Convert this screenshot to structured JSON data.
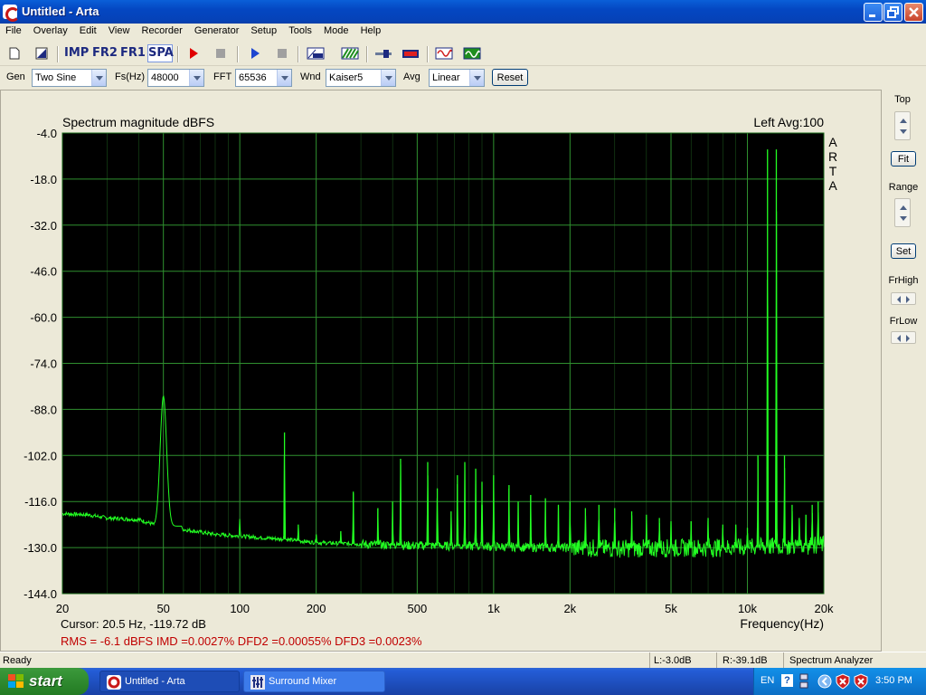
{
  "window": {
    "title": "Untitled - Arta"
  },
  "menu": [
    "File",
    "Overlay",
    "Edit",
    "View",
    "Recorder",
    "Generator",
    "Setup",
    "Tools",
    "Mode",
    "Help"
  ],
  "toolbar": {
    "imp": "IMP",
    "fr2": "FR2",
    "fr1": "FR1",
    "spa": "SPA"
  },
  "options": {
    "gen_label": "Gen",
    "gen_value": "Two Sine",
    "fs_label": "Fs(Hz)",
    "fs_value": "48000",
    "fft_label": "FFT",
    "fft_value": "65536",
    "wnd_label": "Wnd",
    "wnd_value": "Kaiser5",
    "avg_label": "Avg",
    "avg_value": "Linear",
    "reset_label": "Reset"
  },
  "side": {
    "top_label": "Top",
    "fit_label": "Fit",
    "range_label": "Range",
    "set_label": "Set",
    "frhigh_label": "FrHigh",
    "frlow_label": "FrLow"
  },
  "status": {
    "ready": "Ready",
    "left_level": "L:-3.0dB",
    "right_level": "R:-39.1dB",
    "mode": "Spectrum Analyzer"
  },
  "taskbar": {
    "start": "start",
    "tasks": [
      "Untitled - Arta",
      "Surround Mixer"
    ],
    "lang": "EN",
    "help": "?",
    "time": "3:50 PM"
  },
  "colors": {
    "plot_bg": "#000000",
    "grid": "#2F8F2F",
    "trace": "#22FF22",
    "readout_red": "#C00000"
  },
  "chart_data": {
    "type": "line",
    "title": "Spectrum magnitude dBFS",
    "channel_info": "Left  Avg:100",
    "side_label": "ARTA",
    "xlabel": "Frequency(Hz)",
    "x_scale": "log",
    "xlim": [
      20,
      20000
    ],
    "ylim": [
      -144,
      -4
    ],
    "x_tick_labels": [
      "20",
      "50",
      "100",
      "200",
      "500",
      "1k",
      "2k",
      "5k",
      "10k",
      "20k"
    ],
    "x_tick_values": [
      20,
      50,
      100,
      200,
      500,
      1000,
      2000,
      5000,
      10000,
      20000
    ],
    "y_ticks": [
      -4.0,
      -18.0,
      -32.0,
      -46.0,
      -60.0,
      -74.0,
      -88.0,
      -102.0,
      -116.0,
      -130.0,
      -144.0
    ],
    "grid": true,
    "cursor_text": "Cursor:    20.5 Hz, -119.72 dB",
    "readout_text": "RMS =    -6.1 dBFS   IMD =0.0027%   DFD2 =0.00055%   DFD3 =0.0023%",
    "noise_floor": [
      [
        20,
        -119.7
      ],
      [
        25,
        -120
      ],
      [
        30,
        -121
      ],
      [
        40,
        -121.5
      ],
      [
        46,
        -123
      ],
      [
        60,
        -124.5
      ],
      [
        80,
        -126
      ],
      [
        100,
        -126.5
      ],
      [
        150,
        -127.5
      ],
      [
        200,
        -128.5
      ],
      [
        400,
        -129.3
      ],
      [
        1000,
        -129.7
      ],
      [
        3000,
        -130.3
      ],
      [
        10000,
        -130.0
      ],
      [
        20000,
        -129.2
      ]
    ],
    "peaks": [
      {
        "f": 50,
        "db": -84
      },
      {
        "f": 100,
        "db": -121
      },
      {
        "f": 150,
        "db": -95
      },
      {
        "f": 170,
        "db": -123
      },
      {
        "f": 200,
        "db": -126
      },
      {
        "f": 250,
        "db": -125
      },
      {
        "f": 280,
        "db": -113
      },
      {
        "f": 350,
        "db": -118
      },
      {
        "f": 400,
        "db": -116
      },
      {
        "f": 430,
        "db": -103
      },
      {
        "f": 550,
        "db": -104
      },
      {
        "f": 600,
        "db": -112
      },
      {
        "f": 680,
        "db": -119
      },
      {
        "f": 720,
        "db": -108
      },
      {
        "f": 770,
        "db": -104
      },
      {
        "f": 850,
        "db": -106
      },
      {
        "f": 900,
        "db": -110
      },
      {
        "f": 1000,
        "db": -108
      },
      {
        "f": 1150,
        "db": -111
      },
      {
        "f": 1250,
        "db": -116
      },
      {
        "f": 1400,
        "db": -114
      },
      {
        "f": 1600,
        "db": -115
      },
      {
        "f": 1800,
        "db": -117
      },
      {
        "f": 2000,
        "db": -116
      },
      {
        "f": 2300,
        "db": -118
      },
      {
        "f": 2600,
        "db": -117
      },
      {
        "f": 3000,
        "db": -118
      },
      {
        "f": 3500,
        "db": -119
      },
      {
        "f": 4000,
        "db": -120
      },
      {
        "f": 4500,
        "db": -121
      },
      {
        "f": 5000,
        "db": -122
      },
      {
        "f": 6000,
        "db": -122
      },
      {
        "f": 7000,
        "db": -121
      },
      {
        "f": 8000,
        "db": -123
      },
      {
        "f": 9000,
        "db": -123
      },
      {
        "f": 10000,
        "db": -124
      },
      {
        "f": 11000,
        "db": -102
      },
      {
        "f": 12000,
        "db": -9
      },
      {
        "f": 13000,
        "db": -9
      },
      {
        "f": 14000,
        "db": -102
      },
      {
        "f": 15000,
        "db": -117
      },
      {
        "f": 16000,
        "db": -121
      },
      {
        "f": 17000,
        "db": -120
      },
      {
        "f": 18000,
        "db": -117
      },
      {
        "f": 19000,
        "db": -116
      }
    ]
  }
}
